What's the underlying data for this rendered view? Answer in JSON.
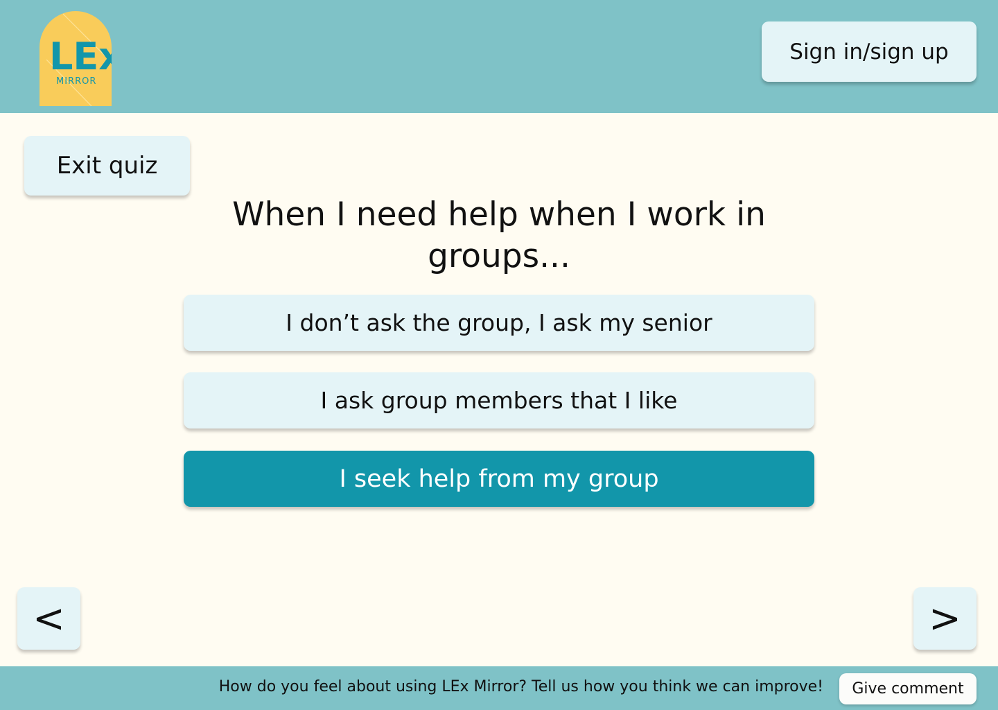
{
  "header": {
    "logo": {
      "main_text": "LEx",
      "sub_text": "MIRROR",
      "bg_color": "#f9cc5a",
      "text_color": "#1296aa"
    },
    "signin_label": "Sign in/sign up"
  },
  "quiz": {
    "exit_label": "Exit quiz",
    "question": "When I need help when I work in groups...",
    "options": [
      {
        "label": "I don’t ask the group, I ask my senior",
        "selected": false
      },
      {
        "label": "I ask group members that I like",
        "selected": false
      },
      {
        "label": "I seek help from my group",
        "selected": true
      }
    ],
    "prev_label": "<",
    "next_label": ">"
  },
  "footer": {
    "prompt": "How do you feel about using LEx Mirror? Tell us how you think we can improve!",
    "comment_label": "Give comment"
  },
  "colors": {
    "header_bg": "#7fc2c7",
    "page_bg": "#fffcf2",
    "button_bg": "#e4f4f7",
    "selected_bg": "#1296aa"
  }
}
